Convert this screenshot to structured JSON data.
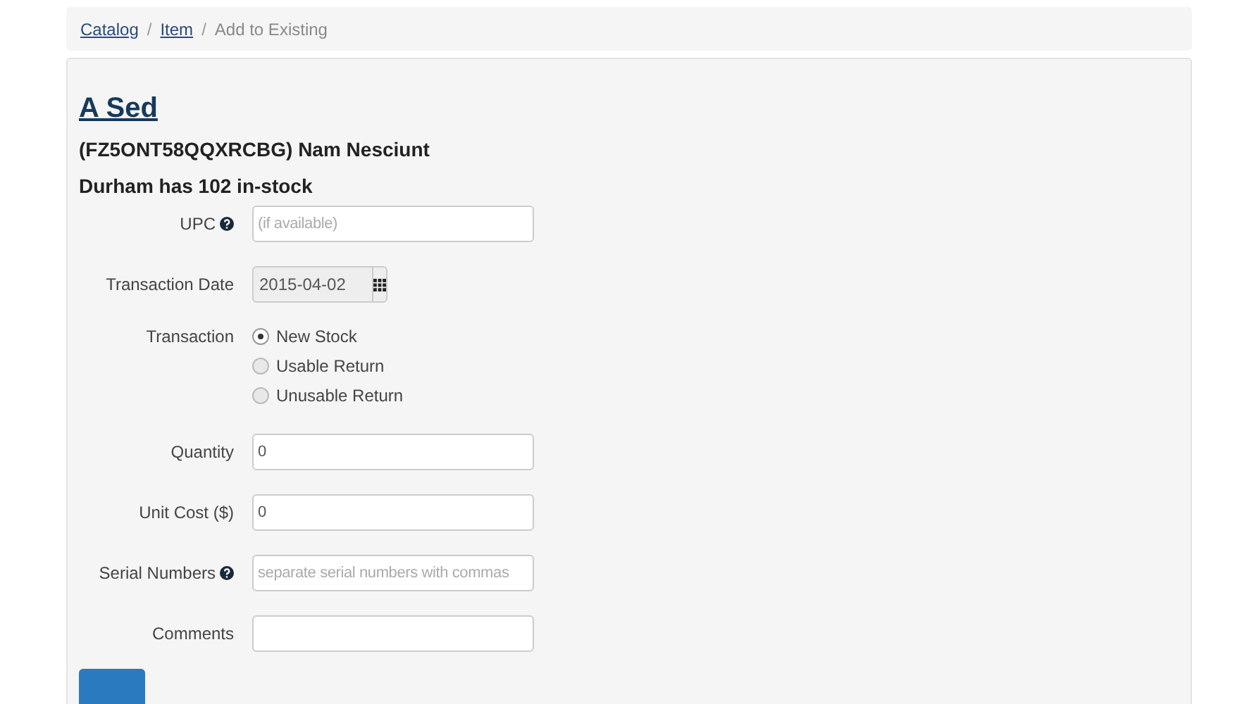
{
  "breadcrumb": [
    {
      "kind": "link",
      "label": "Catalog"
    },
    {
      "kind": "separator",
      "label": "/"
    },
    {
      "kind": "link",
      "label": "Item"
    },
    {
      "kind": "separator",
      "label": "/"
    },
    {
      "kind": "current",
      "label": "Add to Existing"
    }
  ],
  "title": "A Sed",
  "subtitle": "(FZ5ONT58QQXRCBG) Nam Nesciunt",
  "stock": "Durham has 102 in-stock",
  "fields": [
    {
      "kind": "text",
      "label": "UPC",
      "help": true,
      "placeholder": "(if available)"
    },
    {
      "kind": "date",
      "label": "Transaction Date",
      "help": false,
      "value": "2015-04-02"
    },
    {
      "kind": "radio",
      "label": "Transaction",
      "help": false,
      "options": [
        {
          "label": "New Stock",
          "selected": true
        },
        {
          "label": "Usable Return",
          "selected": false
        },
        {
          "label": "Unusable Return",
          "selected": false
        }
      ]
    },
    {
      "kind": "text",
      "label": "Quantity",
      "help": false,
      "value": "0"
    },
    {
      "kind": "text",
      "label": "Unit Cost ($)",
      "help": false,
      "value": "0"
    },
    {
      "kind": "text",
      "label": "Serial Numbers",
      "help": true,
      "placeholder": "separate serial numbers with commas"
    },
    {
      "kind": "text",
      "label": "Comments",
      "help": false
    }
  ]
}
